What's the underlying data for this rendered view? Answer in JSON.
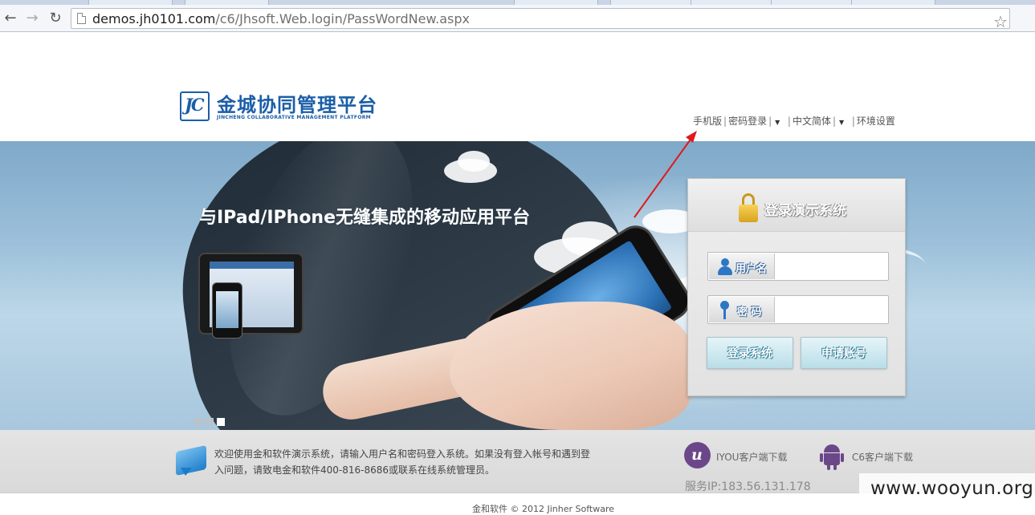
{
  "browser": {
    "back_icon": "arrow-left-icon",
    "forward_icon": "arrow-right-icon",
    "reload_icon": "reload-icon",
    "url_host": "demos.jh0101.com",
    "url_path": "/c6/Jhsoft.Web.login/PassWordNew.aspx",
    "bookmark_icon": "star-icon"
  },
  "header": {
    "logo_mark": "JC",
    "logo_title": "金城协同管理平台",
    "logo_subtitle": "JINCHENG COLLABORATIVE MANAGEMENT PLATFORM",
    "nav": {
      "mobile": "手机版",
      "password_login": "密码登录",
      "language": "中文简体",
      "env_settings": "环境设置"
    }
  },
  "banner": {
    "tagline": "与IPad/IPhone无缝集成的移动应用平台",
    "slides": 3,
    "active_slide": 3
  },
  "login": {
    "title": "登录演示系统",
    "username_label": "用户名",
    "username_value": "",
    "password_label": "密 码",
    "password_value": "",
    "login_button": "登录系统",
    "apply_button": "申请账号"
  },
  "footer": {
    "welcome": "欢迎使用金和软件演示系统，请输入用户名和密码登入系统。如果没有登入帐号和遇到登入问题，请致电金和软件400-816-8686或联系在线系统管理员。",
    "iyou_download": "IYOU客户端下载",
    "c6_download": "C6客户端下载",
    "server_ip": "服务IP:183.56.131.178",
    "copyright": "金和软件 © 2012 Jinher Software"
  },
  "watermark": "www.wooyun.org",
  "colors": {
    "brand_blue": "#1b5ea8",
    "annotation_arrow": "#e0191c",
    "icon_purple": "#6b4789"
  }
}
